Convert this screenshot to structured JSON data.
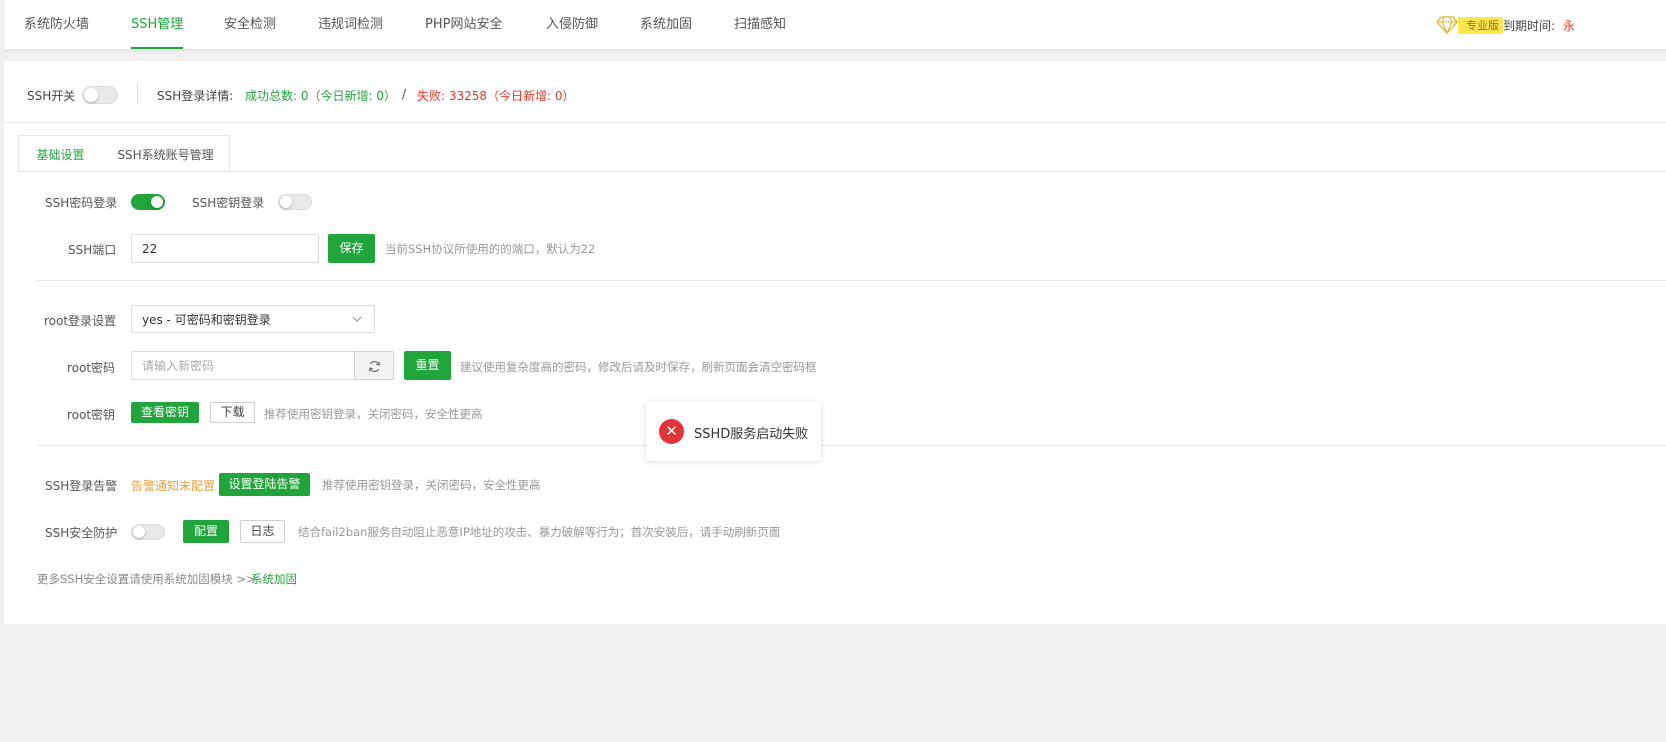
{
  "nav": {
    "tabs": [
      {
        "label": "系统防火墙"
      },
      {
        "label": "SSH管理"
      },
      {
        "label": "安全检测"
      },
      {
        "label": "违规词检测"
      },
      {
        "label": "PHP网站安全"
      },
      {
        "label": "入侵防御"
      },
      {
        "label": "系统加固"
      },
      {
        "label": "扫描感知"
      }
    ],
    "active_tab": "SSH管理",
    "pro_badge": "专业版",
    "expire_label": "到期时间:",
    "expire_value": "永"
  },
  "status": {
    "switch_label": "SSH开关",
    "switch_on": false,
    "detail_label": "SSH登录详情:",
    "success_text": "成功总数: 0（今日新增: 0）",
    "separator": "/",
    "fail_text": "失败: 33258（今日新增: 0）"
  },
  "subtabs": [
    {
      "label": "基础设置"
    },
    {
      "label": "SSH系统账号管理"
    }
  ],
  "basic": {
    "password_login_label": "SSH密码登录",
    "password_login_on": true,
    "key_login_label": "SSH密钥登录",
    "key_login_on": false,
    "port_label": "SSH端口",
    "port_value": "22",
    "save_label": "保存",
    "port_hint": "当前SSH协议所使用的的端口，默认为22",
    "root_login_label": "root登录设置",
    "root_login_value": "yes - 可密码和密钥登录",
    "root_password_label": "root密码",
    "root_password_placeholder": "请输入新密码",
    "reset_label": "重置",
    "root_password_hint": "建议使用复杂度高的密码，修改后请及时保存，刷新页面会清空密码框",
    "root_key_label": "root密钥",
    "view_key_label": "查看密钥",
    "download_label": "下载",
    "root_key_hint": "推荐使用密钥登录，关闭密码，安全性更高",
    "alarm_label": "SSH登录告警",
    "alarm_status": "告警通知未配置",
    "alarm_button": "设置登陆告警",
    "alarm_hint": "推荐使用密钥登录，关闭密码，安全性更高",
    "protect_label": "SSH安全防护",
    "protect_on": false,
    "config_label": "配置",
    "log_label": "日志",
    "protect_hint": "结合fail2ban服务自动阻止恶意IP地址的攻击、暴力破解等行为；首次安装后，请手动刷新页面",
    "footer_text": "更多SSH安全设置请使用系统加固模块 >>",
    "footer_link": "系统加固"
  },
  "toast": {
    "message": "SSHD服务启动失败",
    "icon": "error-icon"
  },
  "colors": {
    "accent": "#20a53a",
    "success": "#20a53a",
    "danger": "#e9392a",
    "warning": "#e6a23c"
  }
}
